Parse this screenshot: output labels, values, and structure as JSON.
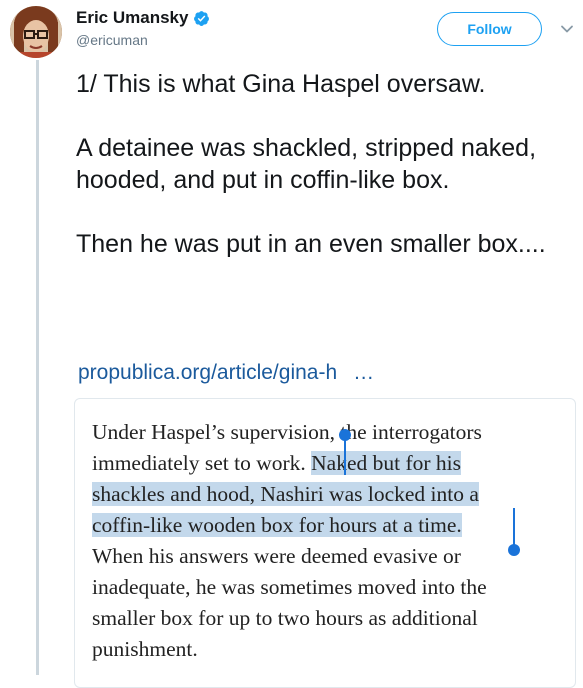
{
  "user": {
    "display_name": "Eric Umansky",
    "handle": "@ericuman",
    "verified": true
  },
  "follow_button": {
    "label": "Follow"
  },
  "tweet": {
    "paragraphs": [
      "1/ This is what Gina Haspel oversaw.",
      "A detainee was shackled, stripped naked, hooded, and put in coffin-like box.",
      "Then he was put in an even smaller box...."
    ],
    "link": {
      "text": "propublica.org/article/gina-h",
      "ellipsis": "…"
    }
  },
  "quote_card": {
    "lines": [
      {
        "pre": "Under Haspel’s supervision, the interrogators",
        "hl": "",
        "post": ""
      },
      {
        "pre": "immediately set to work. ",
        "hl": "Naked but for his",
        "post": ""
      },
      {
        "pre": "",
        "hl": "shackles and hood, Nashiri was locked into a",
        "post": ""
      },
      {
        "pre": "",
        "hl": "coffin-like wooden box for hours at a time.",
        "post": ""
      },
      {
        "pre": "When his answers were deemed evasive or",
        "hl": "",
        "post": ""
      },
      {
        "pre": "inadequate, he was sometimes moved into the",
        "hl": "",
        "post": ""
      },
      {
        "pre": "smaller box for up to two hours as additional",
        "hl": "",
        "post": ""
      },
      {
        "pre": "punishment.",
        "hl": "",
        "post": ""
      }
    ]
  },
  "colors": {
    "accent": "#1da1f2",
    "link": "#1b5a9c",
    "selection": "#c3d8eb",
    "selection_handle": "#1a73d9"
  },
  "icons": [
    "verified-badge-icon",
    "chevron-down-icon",
    "selection-handle-icon"
  ]
}
